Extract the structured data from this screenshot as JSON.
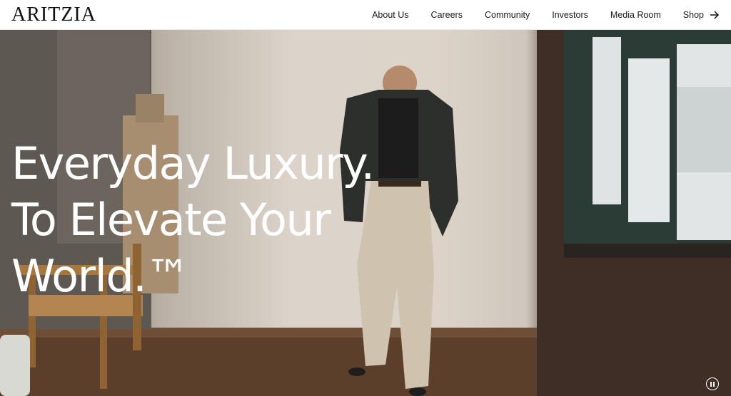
{
  "brand": {
    "logo_text": "ARITZIA"
  },
  "nav": {
    "items": [
      {
        "label": "About Us"
      },
      {
        "label": "Careers"
      },
      {
        "label": "Community"
      },
      {
        "label": "Investors"
      },
      {
        "label": "Media Room"
      },
      {
        "label": "Shop",
        "icon": "arrow-right-icon"
      }
    ]
  },
  "hero": {
    "headline_lines": [
      "Everyday Luxury.",
      "To Elevate Your",
      "World.™"
    ],
    "pause_icon": "pause-icon"
  }
}
